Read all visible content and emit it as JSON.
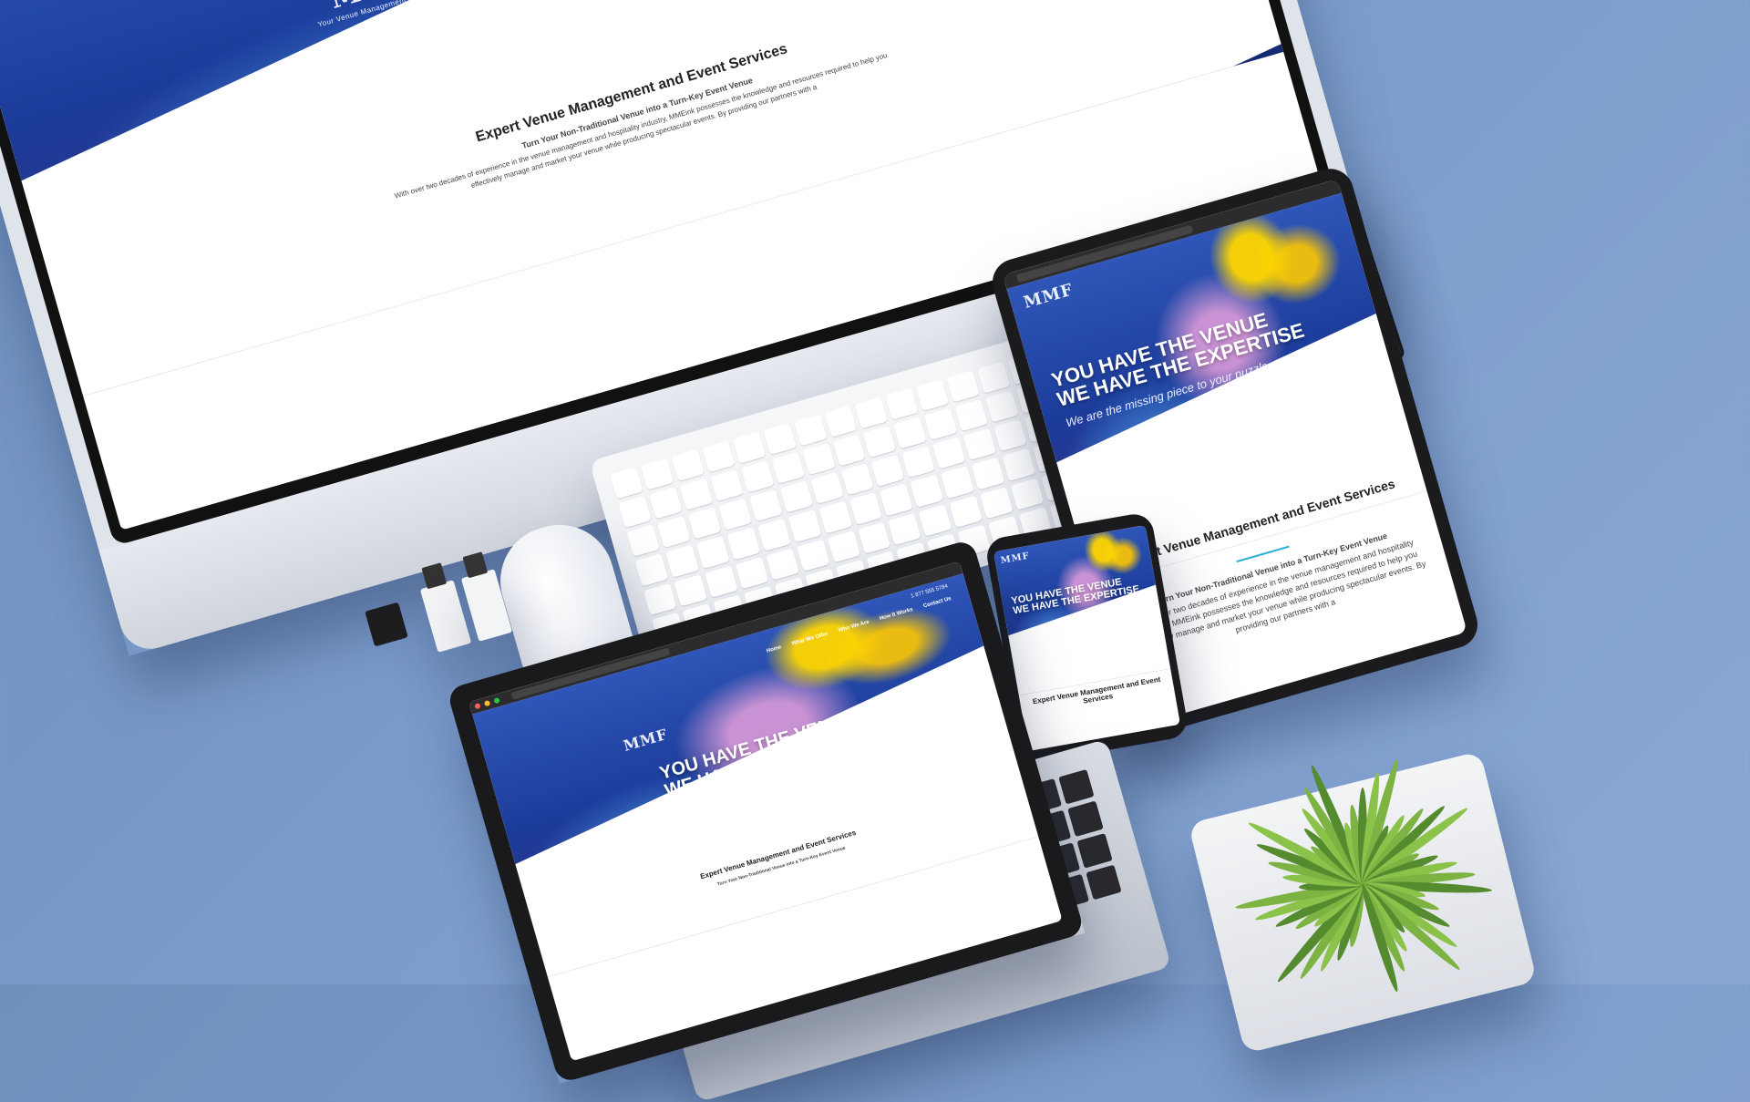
{
  "site": {
    "logo": "MMF",
    "logo_sub": "Your Venue Management Partner",
    "hero_line1_prefix": "YOU HAVE THE ",
    "hero_line1_bold": "VENUE",
    "hero_line2_prefix": "WE HAVE THE ",
    "hero_line2_bold": "EXPERTISE",
    "tagline": "We are the missing piece to your puzzle",
    "section_heading": "Expert Venue Management and Event Services",
    "intro_bold": "Turn Your Non-Traditional Venue into a Turn-Key Event Venue",
    "intro_body": "With over two decades of experience in the venue management and hospitality industry, MMEink possesses the knowledge and resources required to help you effectively manage and market your venue while producing spectacular events. By providing our partners with a"
  },
  "laptop_nav": [
    "Home",
    "What We Offer",
    "Who We Are",
    "How It Works",
    "Contact Us"
  ],
  "laptop_phone": "1 877 555 5784",
  "colors": {
    "accent": "#2ab0d6",
    "hero_blue": "#1c3c9a",
    "desk": "#7b9ccc"
  }
}
